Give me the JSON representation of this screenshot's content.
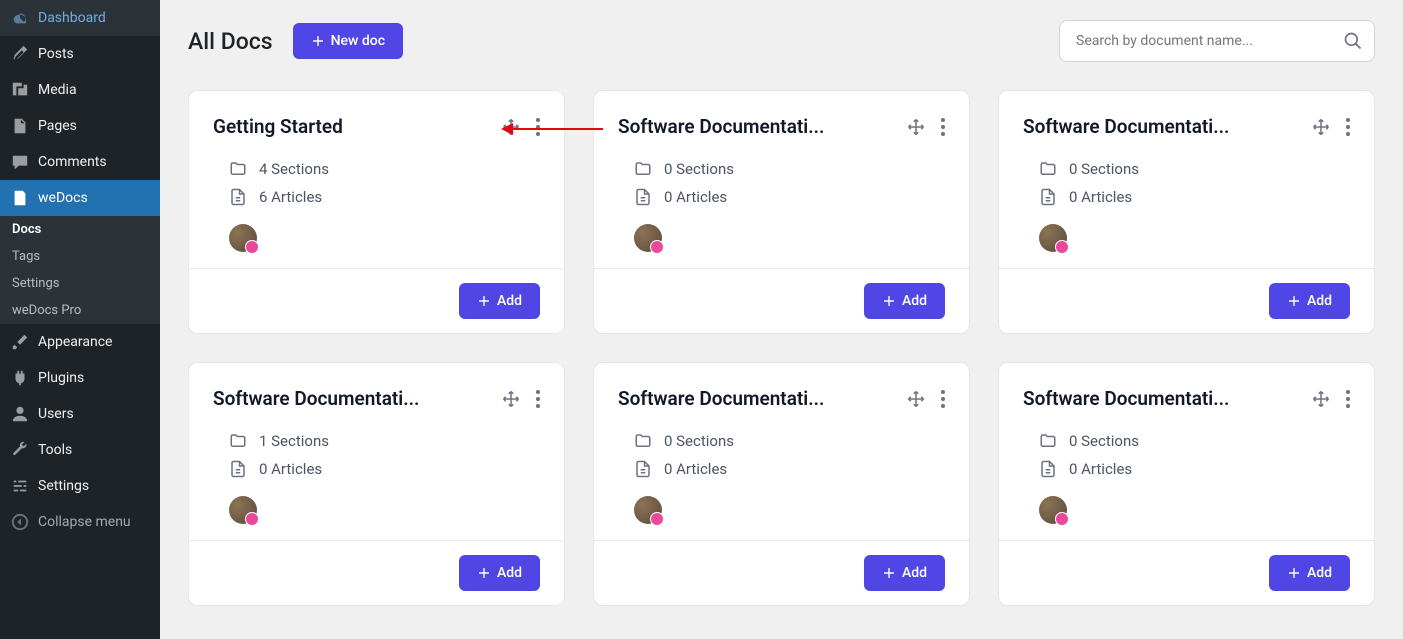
{
  "sidebar": {
    "items": [
      {
        "label": "Dashboard",
        "icon": "dashboard"
      },
      {
        "label": "Posts",
        "icon": "pin"
      },
      {
        "label": "Media",
        "icon": "media"
      },
      {
        "label": "Pages",
        "icon": "page"
      },
      {
        "label": "Comments",
        "icon": "comment"
      },
      {
        "label": "weDocs",
        "icon": "doc"
      },
      {
        "label": "Appearance",
        "icon": "brush"
      },
      {
        "label": "Plugins",
        "icon": "plug"
      },
      {
        "label": "Users",
        "icon": "user"
      },
      {
        "label": "Tools",
        "icon": "wrench"
      },
      {
        "label": "Settings",
        "icon": "sliders"
      },
      {
        "label": "Collapse menu",
        "icon": "collapse"
      }
    ],
    "submenu": [
      {
        "label": "Docs"
      },
      {
        "label": "Tags"
      },
      {
        "label": "Settings"
      },
      {
        "label": "weDocs Pro"
      }
    ]
  },
  "header": {
    "title": "All Docs",
    "newDocLabel": "New doc",
    "searchPlaceholder": "Search by document name..."
  },
  "docs": [
    {
      "title": "Getting Started",
      "sections": "4 Sections",
      "articles": "6 Articles",
      "addLabel": "Add"
    },
    {
      "title": "Software Documentati...",
      "sections": "0 Sections",
      "articles": "0 Articles",
      "addLabel": "Add"
    },
    {
      "title": "Software Documentati...",
      "sections": "0 Sections",
      "articles": "0 Articles",
      "addLabel": "Add"
    },
    {
      "title": "Software Documentati...",
      "sections": "1 Sections",
      "articles": "0 Articles",
      "addLabel": "Add"
    },
    {
      "title": "Software Documentati...",
      "sections": "0 Sections",
      "articles": "0 Articles",
      "addLabel": "Add"
    },
    {
      "title": "Software Documentati...",
      "sections": "0 Sections",
      "articles": "0 Articles",
      "addLabel": "Add"
    }
  ]
}
